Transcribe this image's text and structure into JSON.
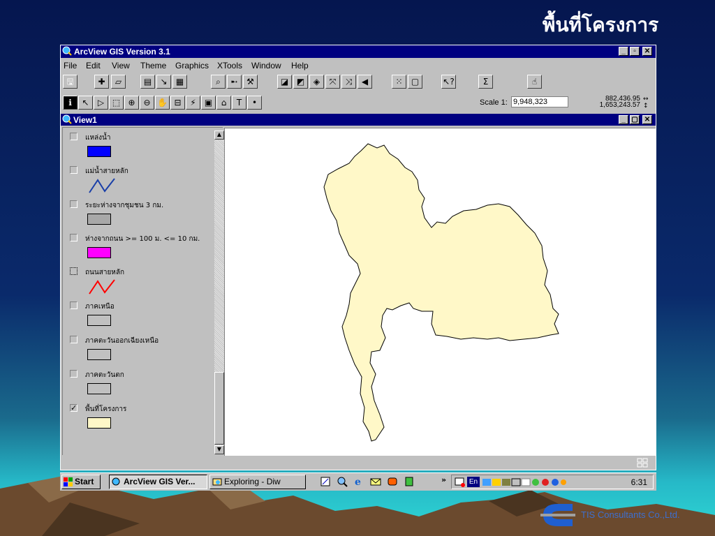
{
  "slide": {
    "title": "พื้นที่โครงการ",
    "footer": "TIS Consultants Co.,Ltd."
  },
  "app": {
    "title": "ArcView GIS Version 3.1",
    "menu": [
      "File",
      "Edit",
      "View",
      "Theme",
      "Graphics",
      "XTools",
      "Window",
      "Help"
    ],
    "scale_label": "Scale 1:",
    "scale_value": "9,948,323",
    "coord_x": "882,436.95",
    "coord_y": "1,653,243.57"
  },
  "view": {
    "title": "View1",
    "layers": [
      {
        "name": "แหล่งน้ำ",
        "checked": false,
        "symbol": "fill",
        "color": "#0000ff"
      },
      {
        "name": "แม่น้ำสายหลัก",
        "checked": false,
        "symbol": "line",
        "color": "#1a3fa8"
      },
      {
        "name": "ระยะห่างจากชุมชน 3 กม.",
        "checked": false,
        "symbol": "fill",
        "color": "#a8a8a8"
      },
      {
        "name": "ห่างจากถนน >= 100 ม. <= 10 กม.",
        "checked": false,
        "symbol": "fill",
        "color": "#ff00ff"
      },
      {
        "name": "ถนนสายหลัก",
        "checked": false,
        "symbol": "line",
        "color": "#ff0000"
      },
      {
        "name": "ภาคเหนือ",
        "checked": false,
        "symbol": "fill",
        "color": "#c0c0c0"
      },
      {
        "name": "ภาคตะวันออกเฉียงเหนือ",
        "checked": false,
        "symbol": "fill",
        "color": "#c0c0c0"
      },
      {
        "name": "ภาคตะวันตก",
        "checked": false,
        "symbol": "fill",
        "color": "#c0c0c0"
      },
      {
        "name": "พื้นที่โครงการ",
        "checked": true,
        "symbol": "fill",
        "color": "#fff8c8"
      }
    ],
    "map_fill": "#fff8c8"
  },
  "taskbar": {
    "start": "Start",
    "tasks": [
      "ArcView GIS Ver...",
      "Exploring - Diw"
    ],
    "lang": "En",
    "clock": "6:31"
  }
}
